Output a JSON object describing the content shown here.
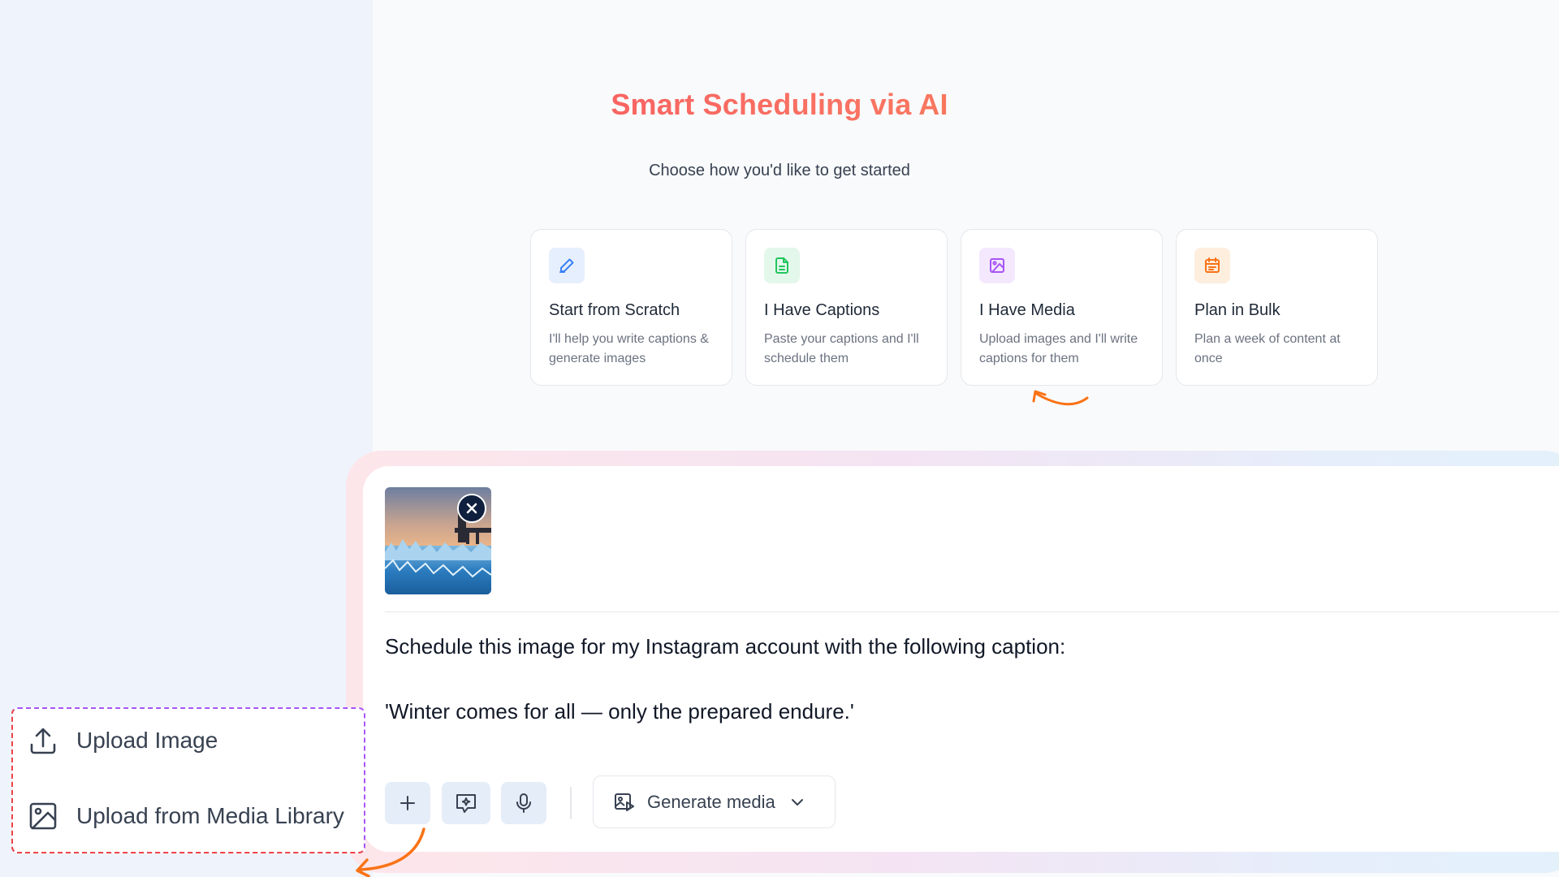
{
  "header": {
    "title": "Smart Scheduling via AI",
    "subtitle": "Choose how you'd like to get started"
  },
  "cards": [
    {
      "title": "Start from Scratch",
      "desc": "I'll help you write captions & generate images",
      "icon": "pencil-icon",
      "color": "#3b82f6",
      "bg": "#e6effd"
    },
    {
      "title": "I Have Captions",
      "desc": "Paste your captions and I'll schedule them",
      "icon": "document-icon",
      "color": "#22c55e",
      "bg": "#e3f7ea"
    },
    {
      "title": "I Have Media",
      "desc": "Upload images and I'll write captions for them",
      "icon": "image-icon",
      "color": "#a855f7",
      "bg": "#f3e8fd"
    },
    {
      "title": "Plan in Bulk",
      "desc": "Plan a week of content at once",
      "icon": "calendar-icon",
      "color": "#f97316",
      "bg": "#fdeede"
    }
  ],
  "composer": {
    "message_line1": "Schedule this image for my Instagram account with the following caption:",
    "message_line2": "'Winter comes for all — only the prepared endure.'",
    "attachment_icon": "image-thumbnail",
    "generate_media_label": "Generate media"
  },
  "upload_menu": {
    "items": [
      {
        "label": "Upload Image",
        "icon": "upload-icon"
      },
      {
        "label": "Upload from Media Library",
        "icon": "image-icon"
      }
    ]
  },
  "colors": {
    "title_gradient": [
      "#f43f5e",
      "#fb923c"
    ],
    "annotation_arrow": "#f97316",
    "menu_dash_purple": "#a855f7",
    "menu_dash_red": "#ef4444"
  }
}
